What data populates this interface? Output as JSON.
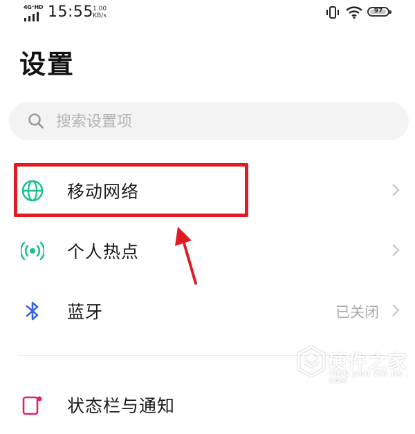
{
  "status_bar": {
    "network_tag": "4G⁺HD",
    "time": "15:55",
    "speed_value": "1.00",
    "speed_unit": "KB/s",
    "battery": "97",
    "battery_level": 0.97
  },
  "page": {
    "title": "设置"
  },
  "search": {
    "placeholder": "搜索设置项",
    "value": ""
  },
  "settings": [
    {
      "label": "移动网络",
      "value": "",
      "icon": "globe-icon",
      "icon_color": "#1dbf8e"
    },
    {
      "label": "个人热点",
      "value": "",
      "icon": "hotspot-icon",
      "icon_color": "#1dbf8e"
    },
    {
      "label": "蓝牙",
      "value": "已关闭",
      "icon": "bluetooth-icon",
      "icon_color": "#3a64e8"
    },
    {
      "label": "状态栏与通知",
      "value": "",
      "icon": "status-bar-icon",
      "icon_color": "#e0245e"
    }
  ],
  "annotation": {
    "highlight_color": "#e01b24"
  },
  "watermark": {
    "text": "硬件之家",
    "pinyin": "YING JIAN ZHI JIA . COM"
  }
}
